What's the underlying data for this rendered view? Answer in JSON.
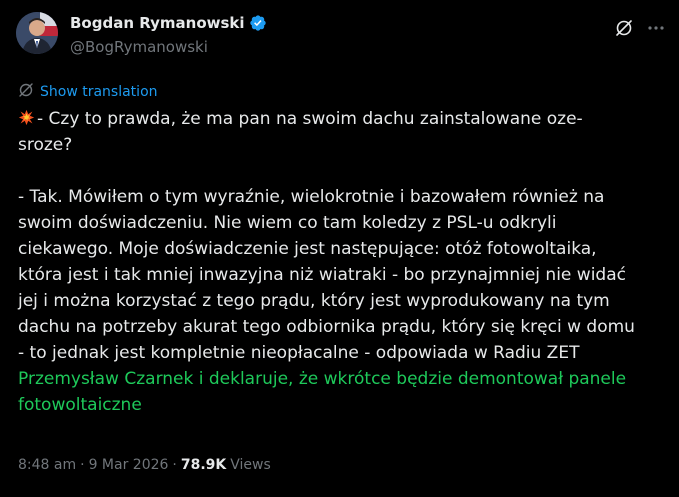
{
  "author": {
    "display_name": "Bogdan Rymanowski",
    "handle": "@BogRymanowski",
    "verified": true
  },
  "translate": {
    "label": "Show translation"
  },
  "post": {
    "line1": "- Czy to prawda, że ma pan na swoim dachu zainstalowane oze-",
    "line2": "sroze?",
    "line3": "- Tak. Mówiłem o tym wyraźnie, wielokrotnie i bazowałem również na",
    "line4": "swoim doświadczeniu. Nie wiem co tam koledzy z PSL-u odkryli",
    "line5": "ciekawego. Moje doświadczenie jest następujące: otóż fotowoltaika,",
    "line6": "która jest i tak mniej inwazyjna niż wiatraki - bo przynajmniej nie widać",
    "line7": "jej i można korzystać z tego prądu, który jest wyprodukowany na tym",
    "line8": "dachu na potrzeby akurat tego odbiornika prądu, który się kręci w domu",
    "line9": "- to jednak jest kompletnie nieopłacalne  - odpowiada w Radiu ZET",
    "line10": "Przemysław Czarnek i deklaruje, że wkrótce będzie demontował panele",
    "line11": "fotowoltaiczne"
  },
  "meta": {
    "time": "8:48 am",
    "separator": "·",
    "date": "9 Mar 2026",
    "views_count": "78.9K",
    "views_label": "Views"
  },
  "icons": {
    "verified": "verified-badge-icon",
    "grok": "grok-icon",
    "more": "more-dots-icon",
    "translate": "translate-icon",
    "emoji": "collision-emoji-icon"
  },
  "colors": {
    "background": "#000000",
    "text": "#e7e9ea",
    "muted": "#71767b",
    "link": "#1d9bf0",
    "highlight_green": "#1ec95a"
  }
}
